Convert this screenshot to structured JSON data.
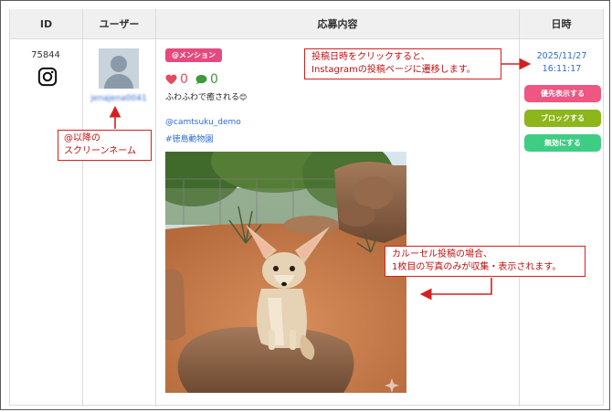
{
  "table": {
    "headers": {
      "id": "ID",
      "user": "ユーザー",
      "content": "応募内容",
      "datetime": "日時"
    }
  },
  "row": {
    "id": "75844",
    "platform_icon": "instagram-icon",
    "screen_name": "jenajena0041",
    "mention_badge": "@メンション",
    "likes": "0",
    "comments": "0",
    "caption": "ふわふわで癒される",
    "caption_emoji": "😊",
    "mention": "@camtsuku_demo",
    "hashtag": "#徳島動物園",
    "date": "2025/11/27",
    "time": "16:11:17",
    "buttons": {
      "priority": "優先表示する",
      "block": "ブロックする",
      "disable": "無効にする"
    }
  },
  "annotations": {
    "screen_name_note": {
      "line1": "@以降の",
      "line2": "スクリーンネーム"
    },
    "date_note": {
      "line1": "投稿日時をクリックすると、",
      "line2": "Instagramの投稿ページに遷移します。"
    },
    "carousel_note": {
      "line1": "カルーセル投稿の場合、",
      "line2": "1枚目の写真のみが収集・表示されます。"
    }
  },
  "colors": {
    "badge": "#e6497e",
    "like": "#e64a5d",
    "comment": "#3e9a3a",
    "link": "#2e6bd1",
    "btn_priority": "#ef5681",
    "btn_block": "#8db51c",
    "btn_disable": "#3fcd83",
    "callout": "#d42020"
  }
}
